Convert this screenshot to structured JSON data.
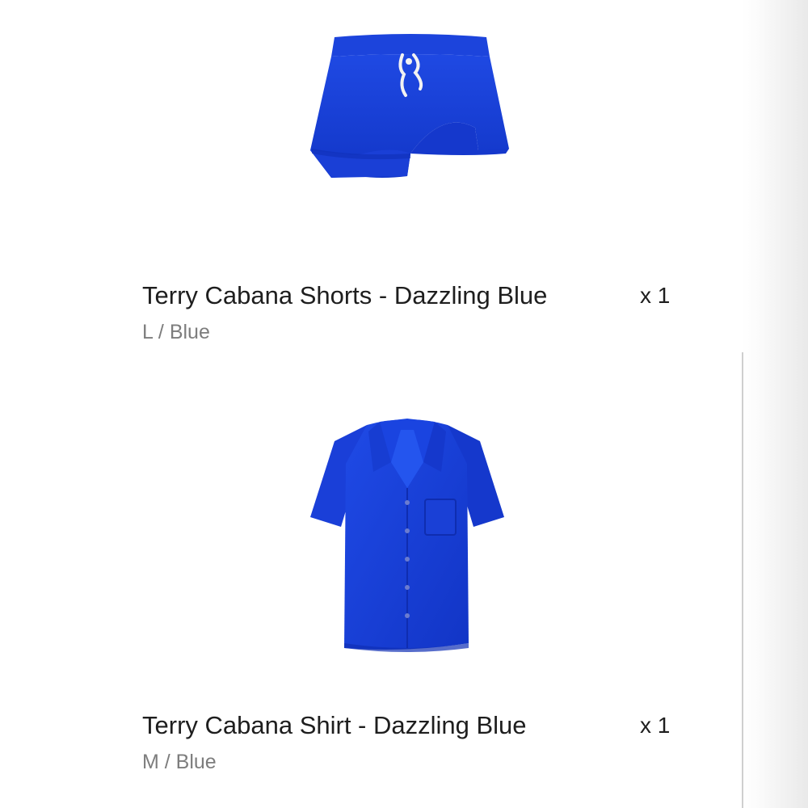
{
  "order": {
    "items": [
      {
        "image_icon": "terry-shorts-image",
        "title": "Terry Cabana Shorts - Dazzling Blue",
        "variant": "L / Blue",
        "quantity": "x 1"
      },
      {
        "image_icon": "terry-shirt-image",
        "title": "Terry Cabana Shirt - Dazzling Blue",
        "variant": "M / Blue",
        "quantity": "x 1"
      }
    ]
  },
  "colors": {
    "product_blue": "#1a3fd6",
    "drawstring_white": "#f2f2f2",
    "title_text": "#1e1e1e",
    "variant_text": "#7d7d7d",
    "background": "#ffffff"
  }
}
